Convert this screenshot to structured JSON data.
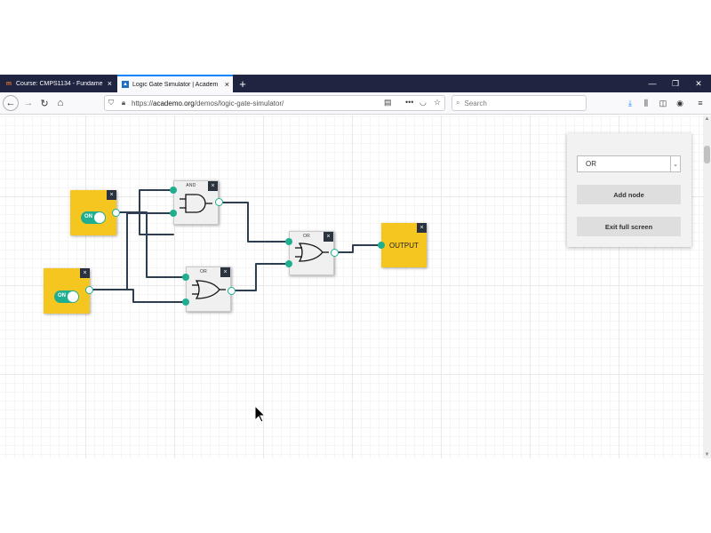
{
  "browser": {
    "tabs": [
      {
        "title": "Course: CMPS1134 - Fundame",
        "favicon": "m-logo-icon",
        "close": "×"
      },
      {
        "title": "Logic Gate Simulator | Academ",
        "favicon": "academo-logo-icon",
        "close": "×",
        "active": true
      }
    ],
    "new_tab": "+",
    "window_controls": {
      "minimize": "—",
      "restore": "❐",
      "close": "✕"
    },
    "nav": {
      "back": "←",
      "forward": "→",
      "reload": "↻",
      "home": "⌂"
    },
    "url": {
      "prefix": "https://",
      "domain": "academo.org",
      "path": "/demos/logic-gate-simulator/"
    },
    "search": {
      "placeholder": "Search"
    },
    "toolbar_icons": [
      "download-icon",
      "library-icon",
      "sidebar-icon",
      "account-icon",
      "menu-icon"
    ],
    "accent": "#0a84ff",
    "titlebar_color": "#1f2440"
  },
  "simulator": {
    "inputs": [
      {
        "state": "ON"
      },
      {
        "state": "ON"
      }
    ],
    "gates": [
      {
        "type": "AND"
      },
      {
        "type": "OR"
      },
      {
        "type": "OR"
      }
    ],
    "output": {
      "label": "OUTPUT"
    },
    "close_glyph": "×",
    "colors": {
      "node": "#f6c620",
      "port": "#1fae8f",
      "wire": "#2c3e50",
      "close_bg": "#2b3340"
    }
  },
  "panel": {
    "gate_select": {
      "value": "OR",
      "options": [
        "OR"
      ]
    },
    "add_node": "Add node",
    "exit_fullscreen": "Exit full screen"
  }
}
